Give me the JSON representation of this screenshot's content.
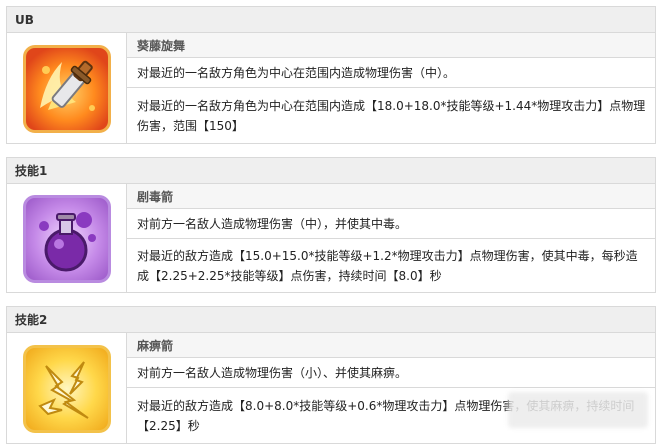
{
  "sections": [
    {
      "header": "UB",
      "skill_name": "葵藤旋舞",
      "icon": "flaming-sword-icon",
      "desc_short": "对最近的一名敌方角色为中心在范围内造成物理伤害（中）。",
      "desc_long": "对最近的一名敌方角色为中心在范围内造成【18.0+18.0*技能等级+1.44*物理攻击力】点物理伤害，范围【150】"
    },
    {
      "header": "技能1",
      "skill_name": "剧毒箭",
      "icon": "poison-flask-icon",
      "desc_short": "对前方一名敌人造成物理伤害（中），并使其中毒。",
      "desc_long": "对最近的敌方造成【15.0+15.0*技能等级+1.2*物理攻击力】点物理伤害，使其中毒，每秒造成【2.25+2.25*技能等级】点伤害，持续时间【8.0】秒"
    },
    {
      "header": "技能2",
      "skill_name": "麻痹箭",
      "icon": "lightning-burst-icon",
      "desc_short": "对前方一名敌人造成物理伤害（小）、并使其麻痹。",
      "desc_long": "对最近的敌方造成【8.0+8.0*技能等级+0.6*物理攻击力】点物理伤害，使其麻痹，持续时间【2.25】秒"
    }
  ],
  "colors": {
    "header_bg": "#efefef",
    "border": "#d9d9d9"
  }
}
